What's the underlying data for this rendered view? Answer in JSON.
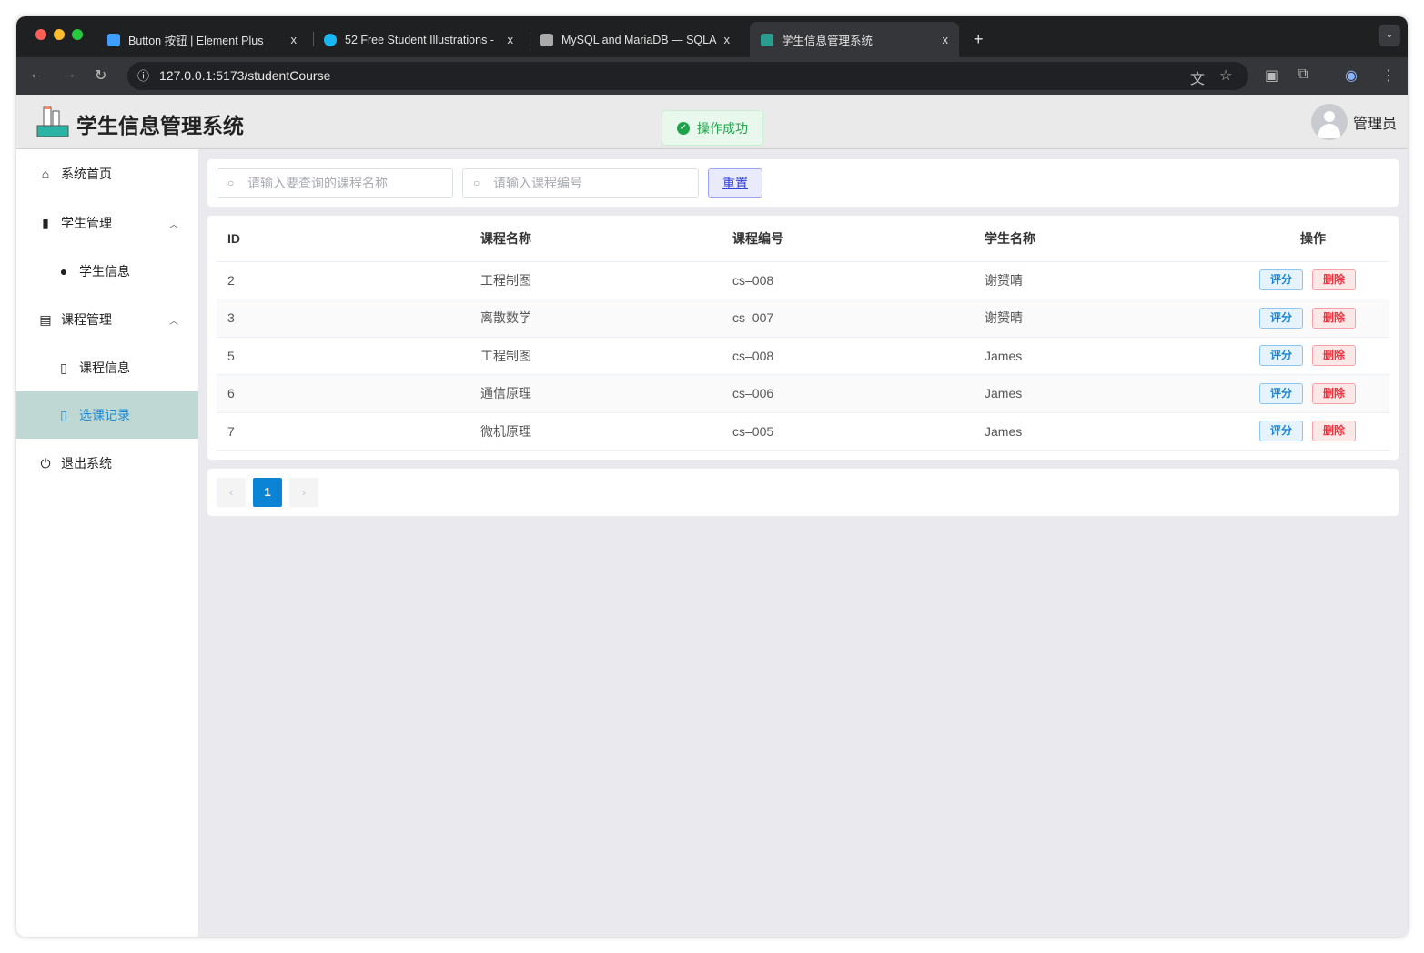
{
  "browser": {
    "tabs": [
      {
        "title": "Button 按钮 | Element Plus",
        "icon": "element-plus-icon",
        "color": "#409eff"
      },
      {
        "title": "52 Free Student Illustrations -",
        "icon": "search-icon",
        "color": "#1ab6f0"
      },
      {
        "title": "MySQL and MariaDB — SQLA",
        "icon": "sqlalchemy-icon",
        "color": "#aaa"
      },
      {
        "title": "学生信息管理系统",
        "icon": "student-icon",
        "color": "#2a9d8f"
      }
    ],
    "url": "127.0.0.1:5173/studentCourse",
    "new_tab": "+",
    "close": "x"
  },
  "app": {
    "title": "学生信息管理系统",
    "toast": "操作成功",
    "user": "管理员"
  },
  "sidebar": {
    "items": [
      {
        "label": "系统首页",
        "icon": "home-icon"
      },
      {
        "label": "学生管理",
        "icon": "book-icon"
      },
      {
        "label": "学生信息",
        "icon": "user-icon"
      },
      {
        "label": "课程管理",
        "icon": "notebook-icon"
      },
      {
        "label": "课程信息",
        "icon": "document-icon"
      },
      {
        "label": "选课记录",
        "icon": "document-icon",
        "active": true
      },
      {
        "label": "退出系统",
        "icon": "power-icon"
      }
    ]
  },
  "search": {
    "course_name_placeholder": "请输入要查询的课程名称",
    "course_no_placeholder": "请输入课程编号",
    "reset": "重置"
  },
  "table": {
    "headers": [
      "ID",
      "课程名称",
      "课程编号",
      "学生名称",
      "操作"
    ],
    "rows": [
      [
        "2",
        "工程制图",
        "cs–008",
        "谢赟晴"
      ],
      [
        "3",
        "离散数学",
        "cs–007",
        "谢赟晴"
      ],
      [
        "5",
        "工程制图",
        "cs–008",
        "James"
      ],
      [
        "6",
        "通信原理",
        "cs–006",
        "James"
      ],
      [
        "7",
        "微机原理",
        "cs–005",
        "James"
      ]
    ],
    "grade": "评分",
    "delete": "删除"
  },
  "pagination": {
    "current": "1",
    "prev": "‹",
    "next": "›"
  }
}
